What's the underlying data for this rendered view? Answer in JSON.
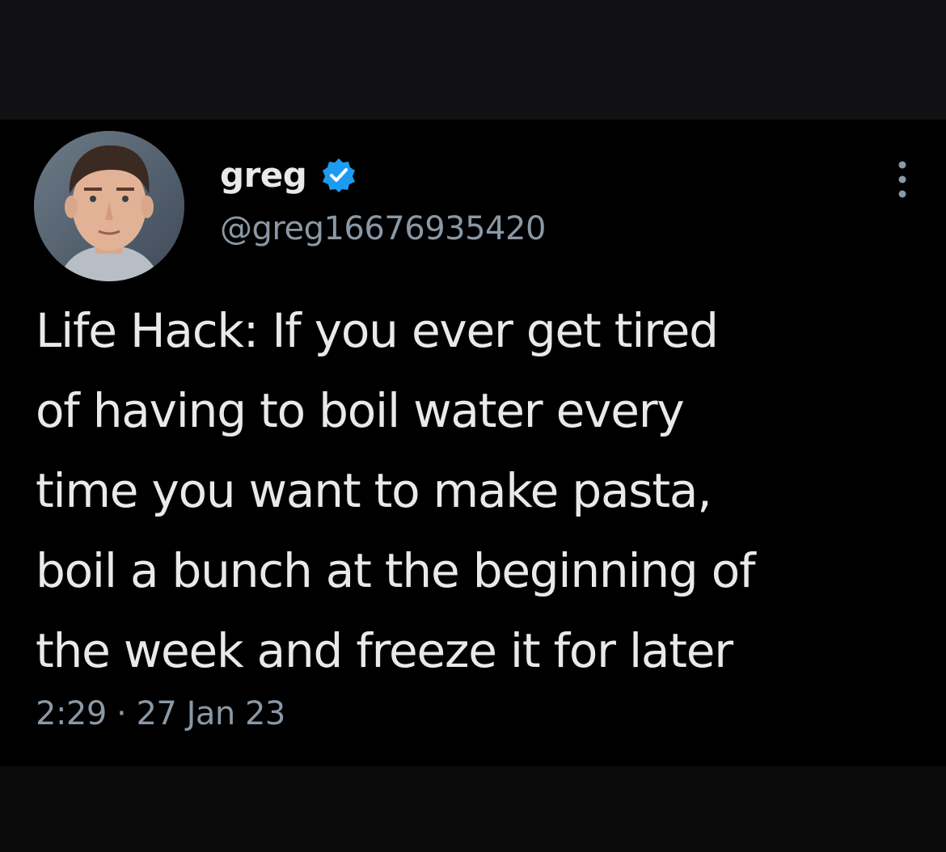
{
  "tweet": {
    "author": {
      "display_name": "greg",
      "handle": "@greg16676935420",
      "verified": true,
      "avatar_icon": "profile-photo"
    },
    "text": "Life Hack: If you ever get tired\nof having to boil water every\ntime you want to make pasta,\nboil a bunch at the beginning of\nthe week and freeze it for later",
    "time": "2:29",
    "separator": "·",
    "date": "27 Jan 23"
  },
  "icons": {
    "verified": "verified-badge-icon",
    "more": "more-options-icon"
  },
  "colors": {
    "background": "#000000",
    "text_primary": "#e7e9ea",
    "text_secondary": "#8b98a5",
    "verified_blue": "#1d9bf0"
  }
}
